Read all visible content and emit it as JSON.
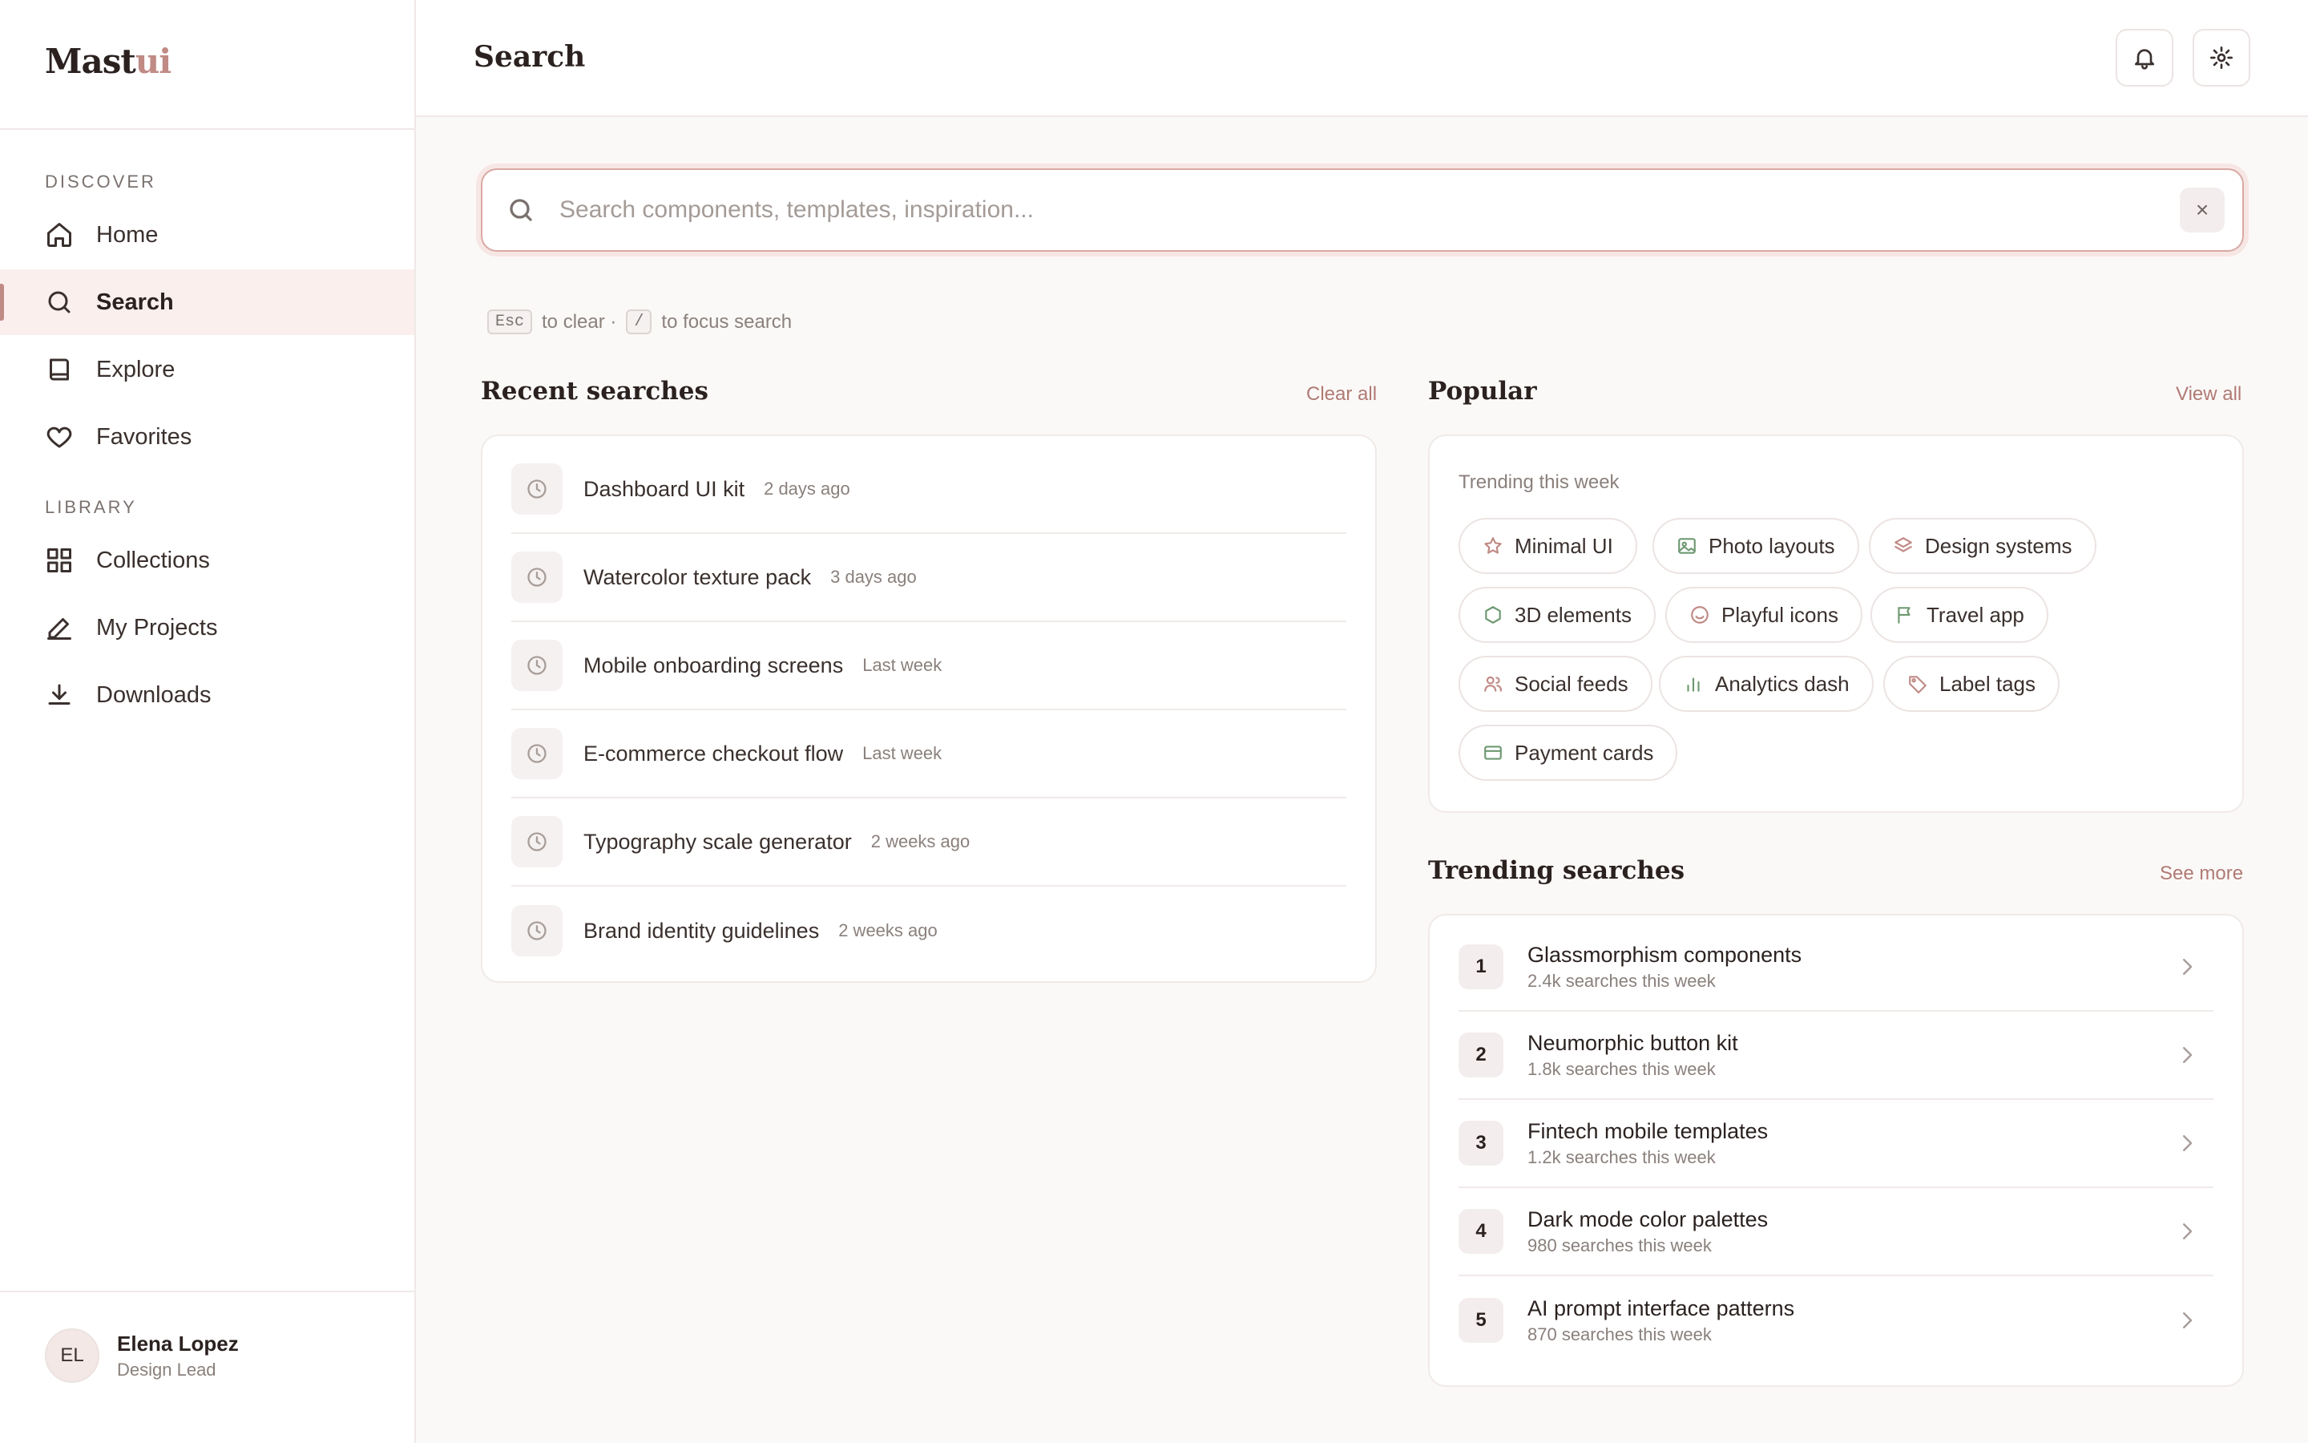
{
  "brand": {
    "name_main": "Mast",
    "name_accent": "ui",
    "accent_color": "#c08a85"
  },
  "sidebar": {
    "sections": [
      {
        "label": "DISCOVER"
      },
      {
        "label": "LIBRARY"
      }
    ],
    "items": [
      {
        "label": "Home",
        "icon": "home-icon",
        "active": false
      },
      {
        "label": "Search",
        "icon": "search-icon",
        "active": true
      },
      {
        "label": "Explore",
        "icon": "book-icon",
        "active": false
      },
      {
        "label": "Favorites",
        "icon": "heart-icon",
        "active": false
      },
      {
        "label": "Collections",
        "icon": "grid-icon",
        "active": false
      },
      {
        "label": "My Projects",
        "icon": "pen-icon",
        "active": false
      },
      {
        "label": "Downloads",
        "icon": "download-icon",
        "active": false
      }
    ],
    "user": {
      "initials": "EL",
      "name": "Elena Lopez",
      "role": "Design Lead"
    }
  },
  "header": {
    "title": "Search",
    "bell_icon": "bell-icon",
    "settings_icon": "gear-icon"
  },
  "search": {
    "placeholder": "Search components, templates, inspiration...",
    "value": "",
    "clear_symbol": "×",
    "hint": {
      "key1": "Esc",
      "text1": "to clear ·",
      "key2": "/",
      "text2": "to focus search"
    }
  },
  "recent": {
    "title": "Recent searches",
    "action": "Clear all",
    "items": [
      {
        "query": "Dashboard UI kit",
        "time": "2 days ago"
      },
      {
        "query": "Watercolor texture pack",
        "time": "3 days ago"
      },
      {
        "query": "Mobile onboarding screens",
        "time": "Last week"
      },
      {
        "query": "E-commerce checkout flow",
        "time": "Last week"
      },
      {
        "query": "Typography scale generator",
        "time": "2 weeks ago"
      },
      {
        "query": "Brand identity guidelines",
        "time": "2 weeks ago"
      }
    ]
  },
  "popular": {
    "title": "Popular",
    "action": "View all",
    "subtitle": "Trending this week",
    "chips": [
      {
        "label": "Minimal UI",
        "icon": "star-icon",
        "color": "#c08a85"
      },
      {
        "label": "Photo layouts",
        "icon": "image-icon",
        "color": "#6f9a72"
      },
      {
        "label": "Design systems",
        "icon": "layers-icon",
        "color": "#c08a85"
      },
      {
        "label": "3D elements",
        "icon": "hexagon-icon",
        "color": "#6f9a72"
      },
      {
        "label": "Playful icons",
        "icon": "smile-icon",
        "color": "#c08a85"
      },
      {
        "label": "Travel app",
        "icon": "flag-icon",
        "color": "#6f9a72"
      },
      {
        "label": "Social feeds",
        "icon": "users-icon",
        "color": "#c08a85"
      },
      {
        "label": "Analytics dash",
        "icon": "bar-chart-icon",
        "color": "#6f9a72"
      },
      {
        "label": "Label tags",
        "icon": "tag-icon",
        "color": "#c08a85"
      },
      {
        "label": "Payment cards",
        "icon": "credit-card-icon",
        "color": "#6f9a72"
      }
    ]
  },
  "trending": {
    "title": "Trending searches",
    "action": "See more",
    "items": [
      {
        "rank": "1",
        "name": "Glassmorphism components",
        "count": "2.4k searches this week"
      },
      {
        "rank": "2",
        "name": "Neumorphic button kit",
        "count": "1.8k searches this week"
      },
      {
        "rank": "3",
        "name": "Fintech mobile templates",
        "count": "1.2k searches this week"
      },
      {
        "rank": "4",
        "name": "Dark mode color palettes",
        "count": "980 searches this week"
      },
      {
        "rank": "5",
        "name": "AI prompt interface patterns",
        "count": "870 searches this week"
      }
    ]
  }
}
